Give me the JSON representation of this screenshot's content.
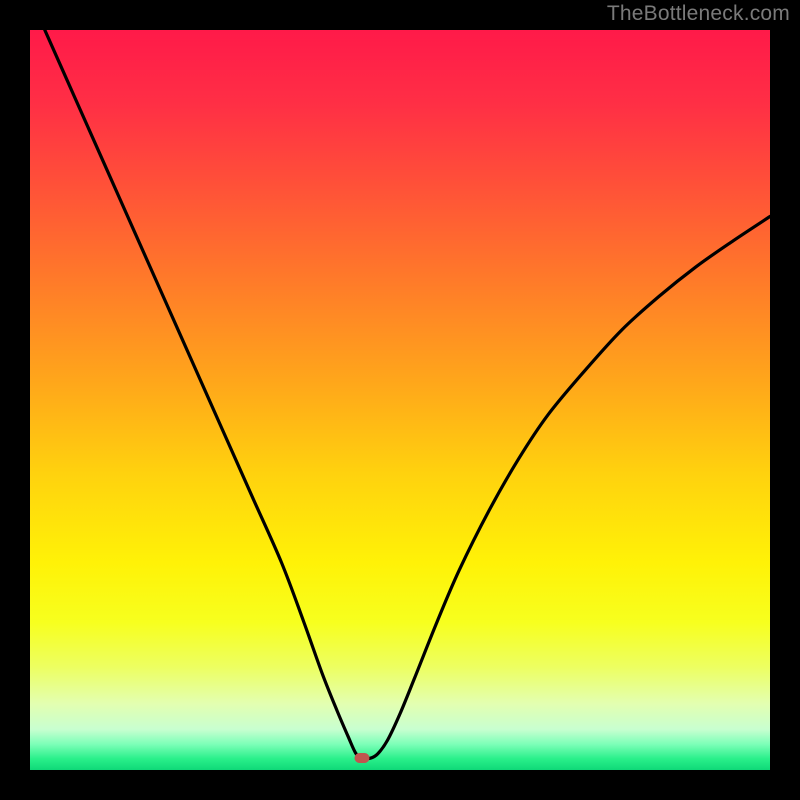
{
  "watermark": "TheBottleneck.com",
  "chart_data": {
    "type": "line",
    "title": "",
    "xlabel": "",
    "ylabel": "",
    "xlim": [
      0,
      100
    ],
    "ylim": [
      0,
      100
    ],
    "series": [
      {
        "name": "bottleneck-curve",
        "x": [
          2,
          6,
          10,
          14,
          18,
          22,
          26,
          30,
          34,
          37,
          39.5,
          41.5,
          43,
          44,
          44.8,
          46,
          47,
          48.3,
          50,
          52,
          55,
          58,
          62,
          66,
          70,
          75,
          80,
          85,
          90,
          95,
          100
        ],
        "y": [
          100,
          91,
          82,
          73,
          64,
          55,
          46,
          37,
          28,
          20,
          13,
          8,
          4.5,
          2.3,
          1.6,
          1.6,
          2.2,
          4,
          7.6,
          12.5,
          20,
          27,
          35,
          42,
          48,
          54,
          59.5,
          64,
          68,
          71.5,
          74.8
        ]
      }
    ],
    "marker": {
      "x": 44.9,
      "y": 1.6
    },
    "gradient_stops": [
      {
        "pos": 0.0,
        "color": "#ff1a49"
      },
      {
        "pos": 0.1,
        "color": "#ff2f45"
      },
      {
        "pos": 0.22,
        "color": "#ff5437"
      },
      {
        "pos": 0.35,
        "color": "#ff7e28"
      },
      {
        "pos": 0.48,
        "color": "#ffa81a"
      },
      {
        "pos": 0.6,
        "color": "#ffd20e"
      },
      {
        "pos": 0.72,
        "color": "#fff207"
      },
      {
        "pos": 0.8,
        "color": "#f7ff1e"
      },
      {
        "pos": 0.86,
        "color": "#edff60"
      },
      {
        "pos": 0.91,
        "color": "#e3ffb0"
      },
      {
        "pos": 0.945,
        "color": "#c8ffd0"
      },
      {
        "pos": 0.965,
        "color": "#7dffb8"
      },
      {
        "pos": 0.985,
        "color": "#29f08a"
      },
      {
        "pos": 1.0,
        "color": "#0fd878"
      }
    ]
  }
}
